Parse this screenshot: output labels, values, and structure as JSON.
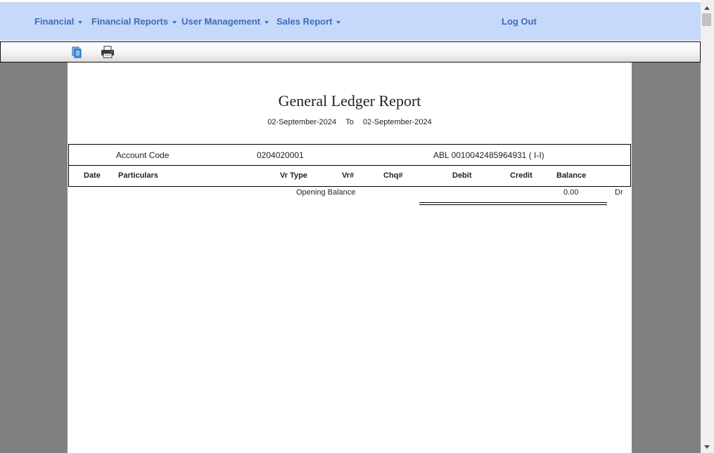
{
  "nav": {
    "items": [
      {
        "label": "Financial"
      },
      {
        "label": "Financial Reports"
      },
      {
        "label": "User Management"
      },
      {
        "label": "Sales Report"
      }
    ],
    "logout_label": "Log Out"
  },
  "toolbar": {
    "icons": [
      "export-document-icon",
      "printer-icon"
    ]
  },
  "report": {
    "title": "General Ledger Report",
    "date_from": "02-September-2024",
    "date_sep": "To",
    "date_to": "02-September-2024",
    "account_code_label": "Account Code",
    "account_code": "0204020001",
    "account_name": "ABL 0010042485964931 ( I-I)",
    "columns": [
      "Date",
      "Particulars",
      "Vr Type",
      "Vr#",
      "Chq#",
      "Debit",
      "Credit",
      "Balance"
    ],
    "opening_balance_label": "Opening Balance",
    "opening_balance_value": "0.00",
    "opening_balance_side": "Dr"
  },
  "colors": {
    "nav_bg": "#c6d9fb",
    "nav_text": "#3d6db5",
    "viewer_bg": "#808080"
  }
}
